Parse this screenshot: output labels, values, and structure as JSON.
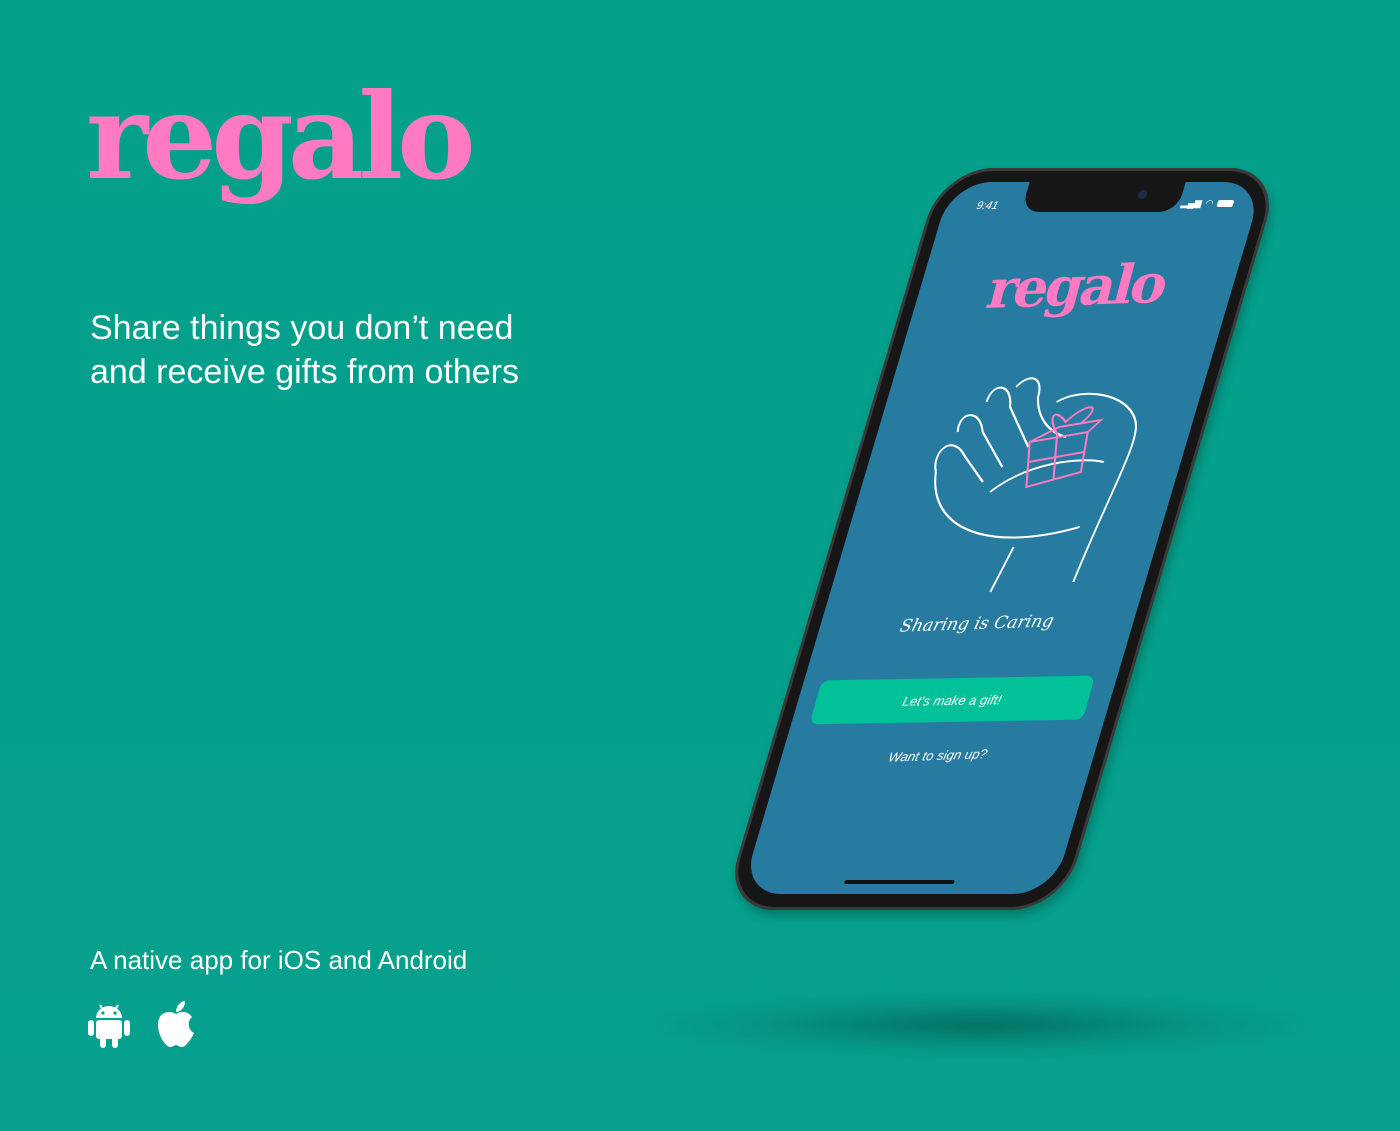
{
  "brand": {
    "logo": "regalo",
    "color": "#ff7ac0"
  },
  "hero": {
    "line1": "Share things you don’t need",
    "line2": "and receive gifts from others"
  },
  "platforms": {
    "label": "A native app for iOS and Android",
    "icons": [
      "android-icon",
      "apple-icon"
    ]
  },
  "phone_screen": {
    "time": "9:41",
    "logo": "regalo",
    "slogan": "Sharing is Caring",
    "primary_button": "Let’s make a gift!",
    "secondary_link": "Want to sign up?",
    "colors": {
      "background": "#277ba0",
      "button": "#00c198"
    }
  },
  "colors": {
    "page_background": "#03a08a"
  }
}
